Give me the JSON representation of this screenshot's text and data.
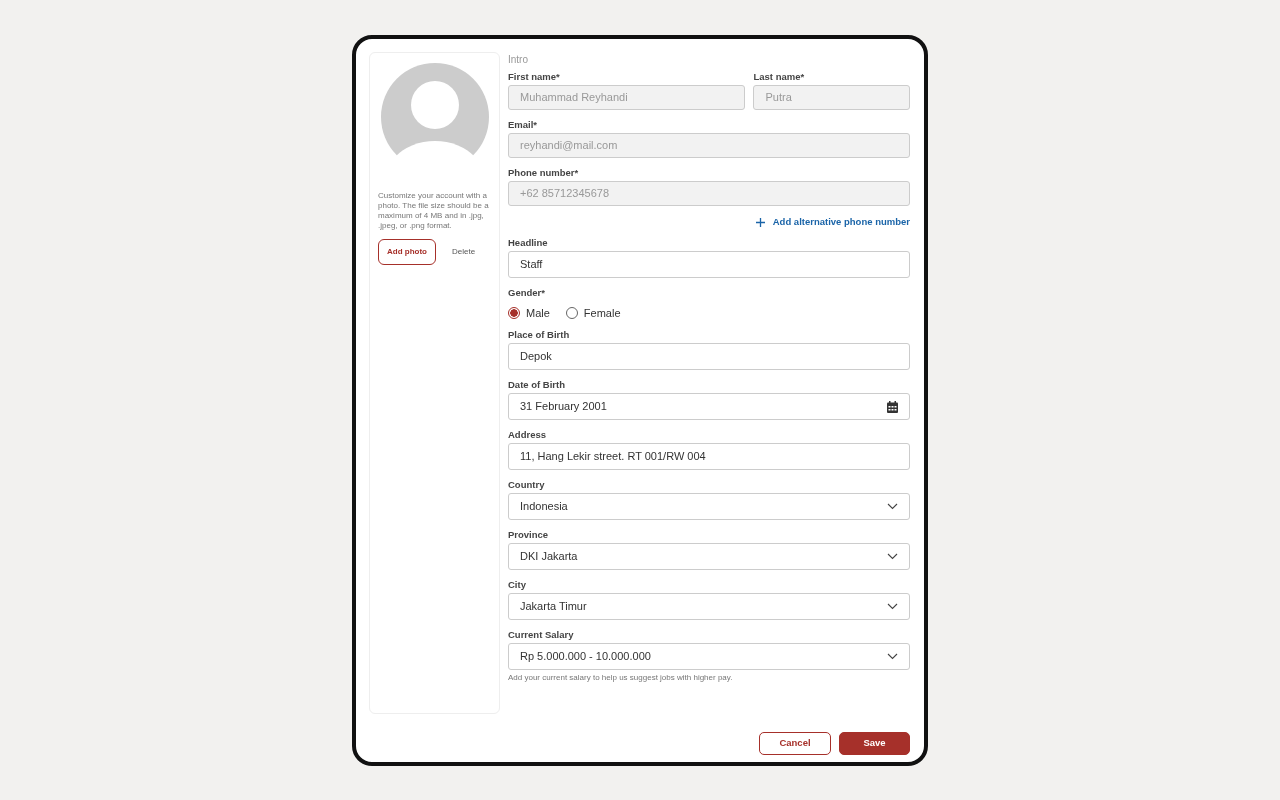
{
  "photo_panel": {
    "description": "Customize your account with a photo. The file size should be a maximum of 4 MB and in .jpg, .jpeg, or .png format.",
    "add_button": "Add photo",
    "delete_button": "Delete"
  },
  "section_title": "Intro",
  "fields": [
    {
      "kind": "row",
      "fields": [
        {
          "kind": "text",
          "label": "First name*",
          "value": "Muhammad Reyhandi",
          "disabled": true
        },
        {
          "kind": "text",
          "label": "Last name*",
          "value": "Putra",
          "disabled": true
        }
      ]
    },
    {
      "kind": "text",
      "label": "Email*",
      "value": "reyhandi@mail.com",
      "disabled": true
    },
    {
      "kind": "text",
      "label": "Phone number*",
      "value": "+62 85712345678",
      "disabled": true
    },
    {
      "kind": "link",
      "label": "Add alternative phone number"
    },
    {
      "kind": "text",
      "label": "Headline",
      "value": "Staff",
      "disabled": false
    },
    {
      "kind": "radio",
      "label": "Gender*",
      "options": [
        {
          "label": "Male",
          "selected": true
        },
        {
          "label": "Female",
          "selected": false
        }
      ]
    },
    {
      "kind": "text",
      "label": "Place of Birth",
      "value": "Depok",
      "disabled": false
    },
    {
      "kind": "date",
      "label": "Date of Birth",
      "value": "31 February 2001"
    },
    {
      "kind": "text",
      "label": "Address",
      "value": "11, Hang Lekir street. RT 001/RW 004",
      "disabled": false
    },
    {
      "kind": "select",
      "label": "Country",
      "value": "Indonesia"
    },
    {
      "kind": "select",
      "label": "Province",
      "value": "DKI Jakarta"
    },
    {
      "kind": "select",
      "label": "City",
      "value": "Jakarta Timur"
    },
    {
      "kind": "select",
      "label": "Current Salary",
      "value": "Rp 5.000.000 - 10.000.000",
      "help": "Add your current salary to help us suggest jobs with higher pay."
    }
  ],
  "buttons": {
    "cancel": "Cancel",
    "save": "Save"
  }
}
